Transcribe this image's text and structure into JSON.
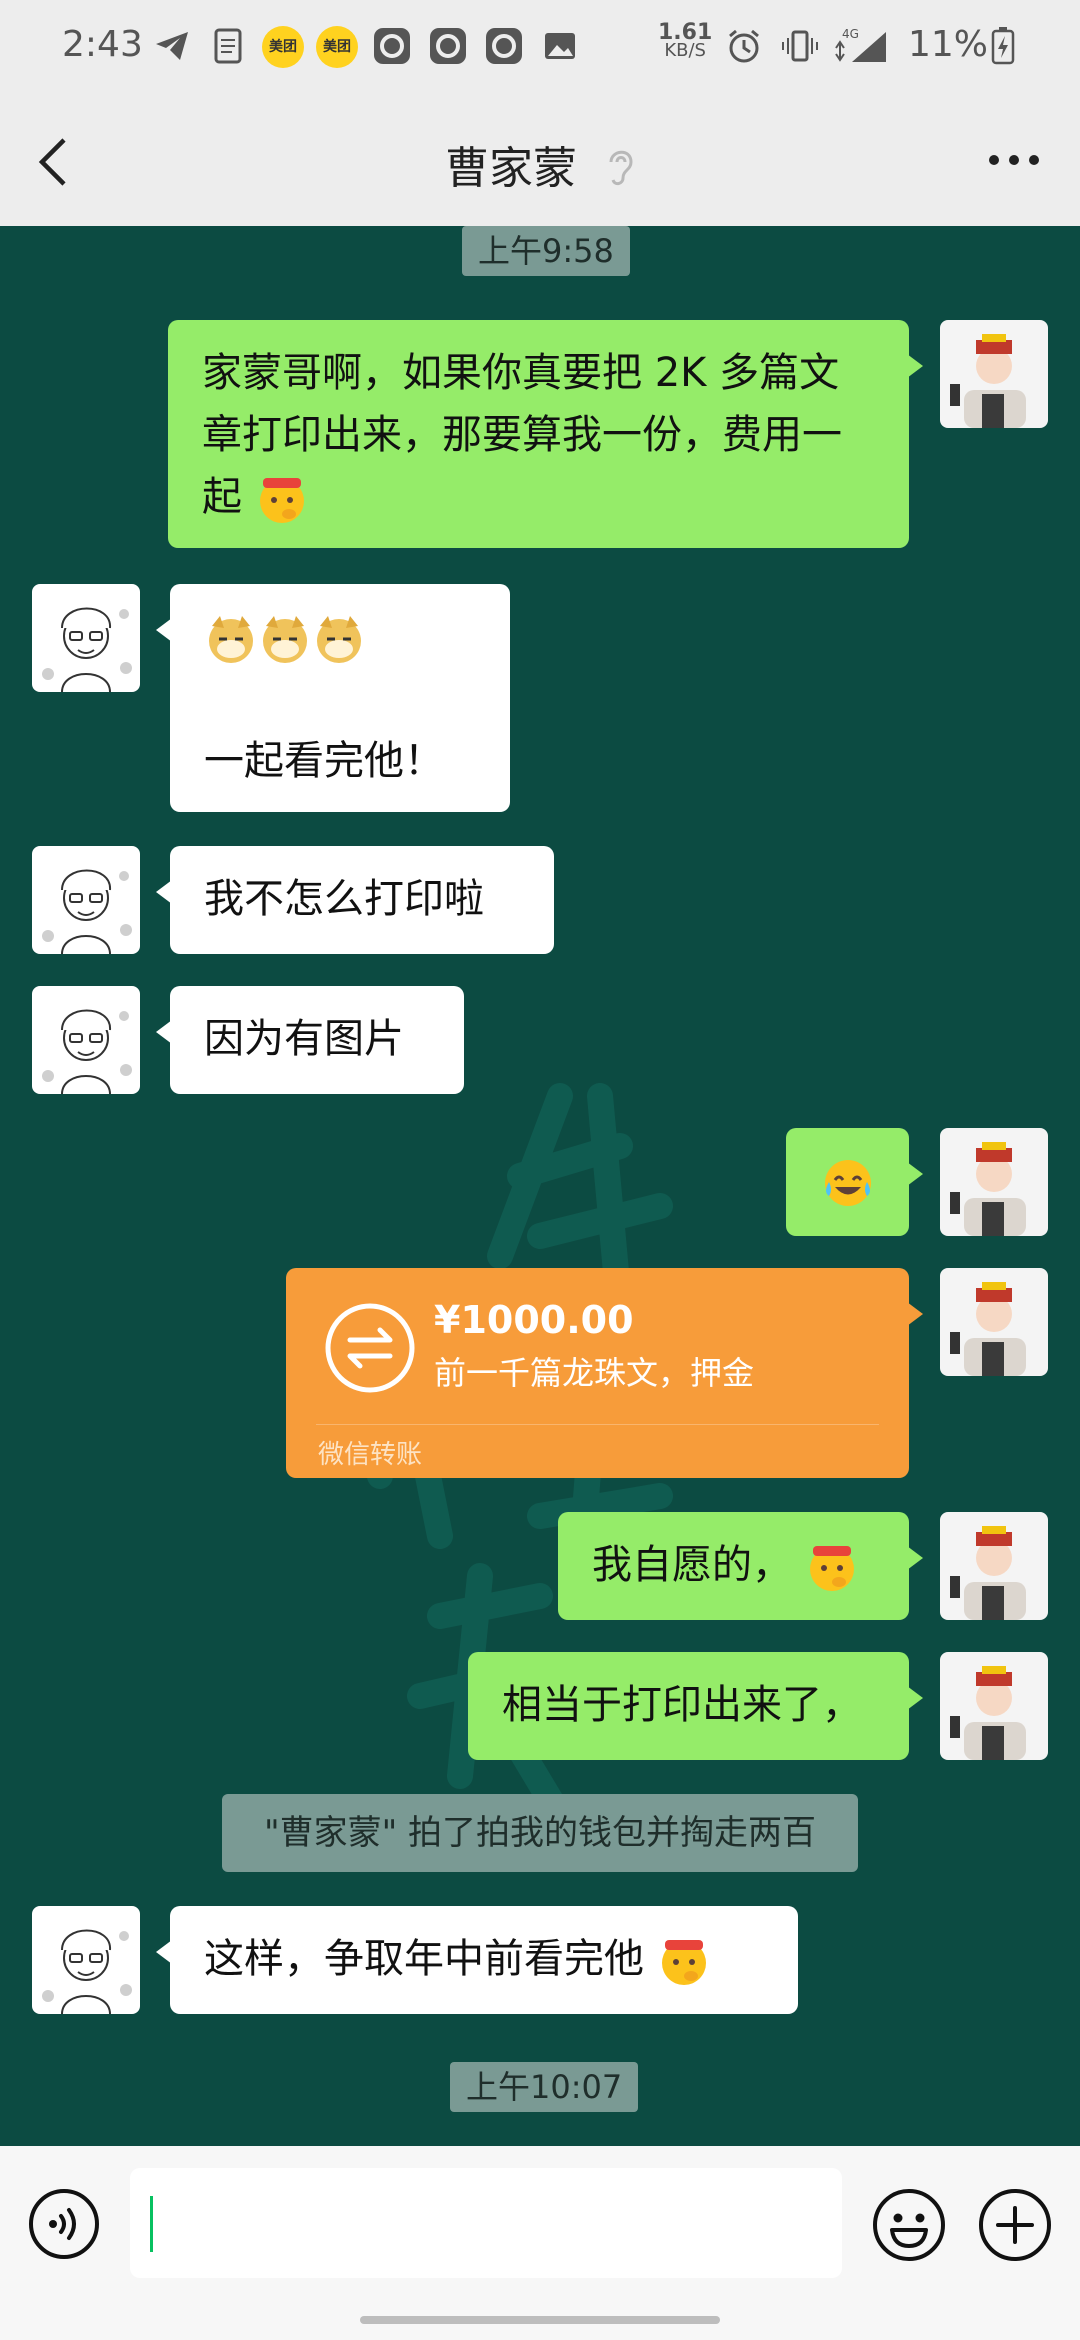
{
  "status_bar": {
    "time": "2:43",
    "meituan_label": "美团",
    "net_speed_value": "1.61",
    "net_speed_unit": "KB/S",
    "network": "4G",
    "battery": "11%"
  },
  "header": {
    "title": "曹家蒙"
  },
  "messages": {
    "ts1": "上午9:58",
    "m1": "家蒙哥啊，如果你真要把 2K 多篇文章打印出来，那要算我一份，费用一起",
    "m2_text": "一起看完他！",
    "m3": "我不怎么打印啦",
    "m4": "因为有图片",
    "m5_emoji": "😂",
    "transfer": {
      "amount": "¥1000.00",
      "note": "前一千篇龙珠文，押金",
      "label": "微信转账"
    },
    "m6": "我自愿的，",
    "m7": "相当于打印出来了，",
    "pat": "\"曹家蒙\" 拍了拍我的钱包并掏走两百",
    "m8": "这样，争取年中前看完他",
    "ts2": "上午10:07"
  },
  "input": {
    "value": ""
  }
}
